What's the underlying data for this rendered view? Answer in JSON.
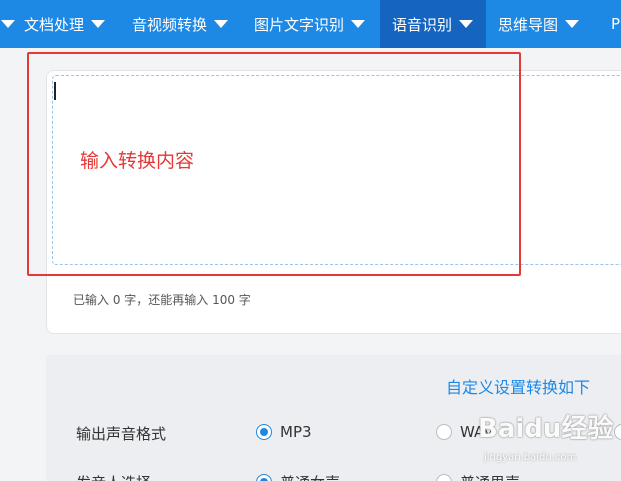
{
  "nav": {
    "items": [
      {
        "label": "",
        "has_caret": true
      },
      {
        "label": "文档处理",
        "has_caret": true
      },
      {
        "label": "音视频转换",
        "has_caret": true
      },
      {
        "label": "图片文字识别",
        "has_caret": true
      },
      {
        "label": "语音识别",
        "has_caret": true,
        "active": true
      },
      {
        "label": "思维导图",
        "has_caret": true
      },
      {
        "label": "P",
        "has_caret": false
      }
    ],
    "bg_color": "#1e88e5",
    "active_color": "#1565c0"
  },
  "editor": {
    "annotation": "输入转换内容",
    "counter": "已输入 0 字，还能再输入 100 字",
    "annotation_color": "#e53935"
  },
  "settings": {
    "custom_link": "自定义设置转换如下",
    "format_label": "输出声音格式",
    "format_options": [
      {
        "label": "MP3",
        "checked": true
      },
      {
        "label": "WAV",
        "checked": false
      }
    ],
    "voice_label": "发音人选择",
    "voice_options": [
      {
        "label": "普通女声",
        "checked": true
      },
      {
        "label": "普通男声",
        "checked": false
      }
    ]
  },
  "watermark": {
    "text": "Baidu经验",
    "url": "jingyan.baidu.com"
  }
}
